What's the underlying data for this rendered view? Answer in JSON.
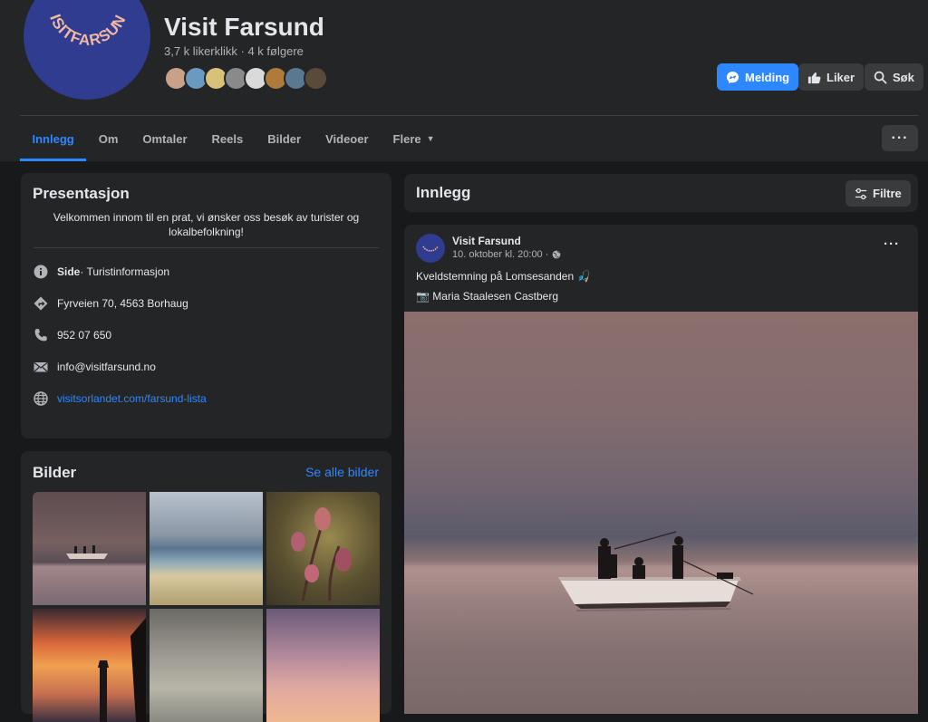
{
  "header": {
    "avatar_text": "VISITFARSUND",
    "page_name": "Visit Farsund",
    "stats": "3,7 k likerklikk · 4 k følgere",
    "buttons": {
      "message": "Melding",
      "like": "Liker",
      "search": "Søk"
    }
  },
  "tabs": [
    {
      "label": "Innlegg",
      "active": true
    },
    {
      "label": "Om"
    },
    {
      "label": "Omtaler"
    },
    {
      "label": "Reels"
    },
    {
      "label": "Bilder"
    },
    {
      "label": "Videoer"
    },
    {
      "label": "Flere"
    }
  ],
  "more_button": "···",
  "intro": {
    "title": "Presentasjon",
    "text": "Velkommen innom til en prat, vi ønsker oss besøk av turister og lokalbefolkning!",
    "category_bold": "Side",
    "category_rest": " · Turistinformasjon",
    "address": "Fyrveien 70, 4563 Borhaug",
    "phone": "952 07 650",
    "email": "info@visitfarsund.no",
    "website": "visitsorlandet.com/farsund-lista"
  },
  "photos": {
    "title": "Bilder",
    "see_all": "Se alle bilder"
  },
  "feed": {
    "title": "Innlegg",
    "filter_label": "Filtre"
  },
  "post": {
    "author": "Visit Farsund",
    "meta": "10. oktober kl. 20:00 ·",
    "text": "Kveldstemning på Lomsesanden 🎣",
    "credit": "📷 Maria Staalesen Castberg",
    "more": "···"
  },
  "colors": {
    "accent": "#2d88ff",
    "background": "#18191a",
    "card": "#242526",
    "avatar_bg": "#2f3c8f",
    "avatar_text": "#f0b8a0"
  }
}
